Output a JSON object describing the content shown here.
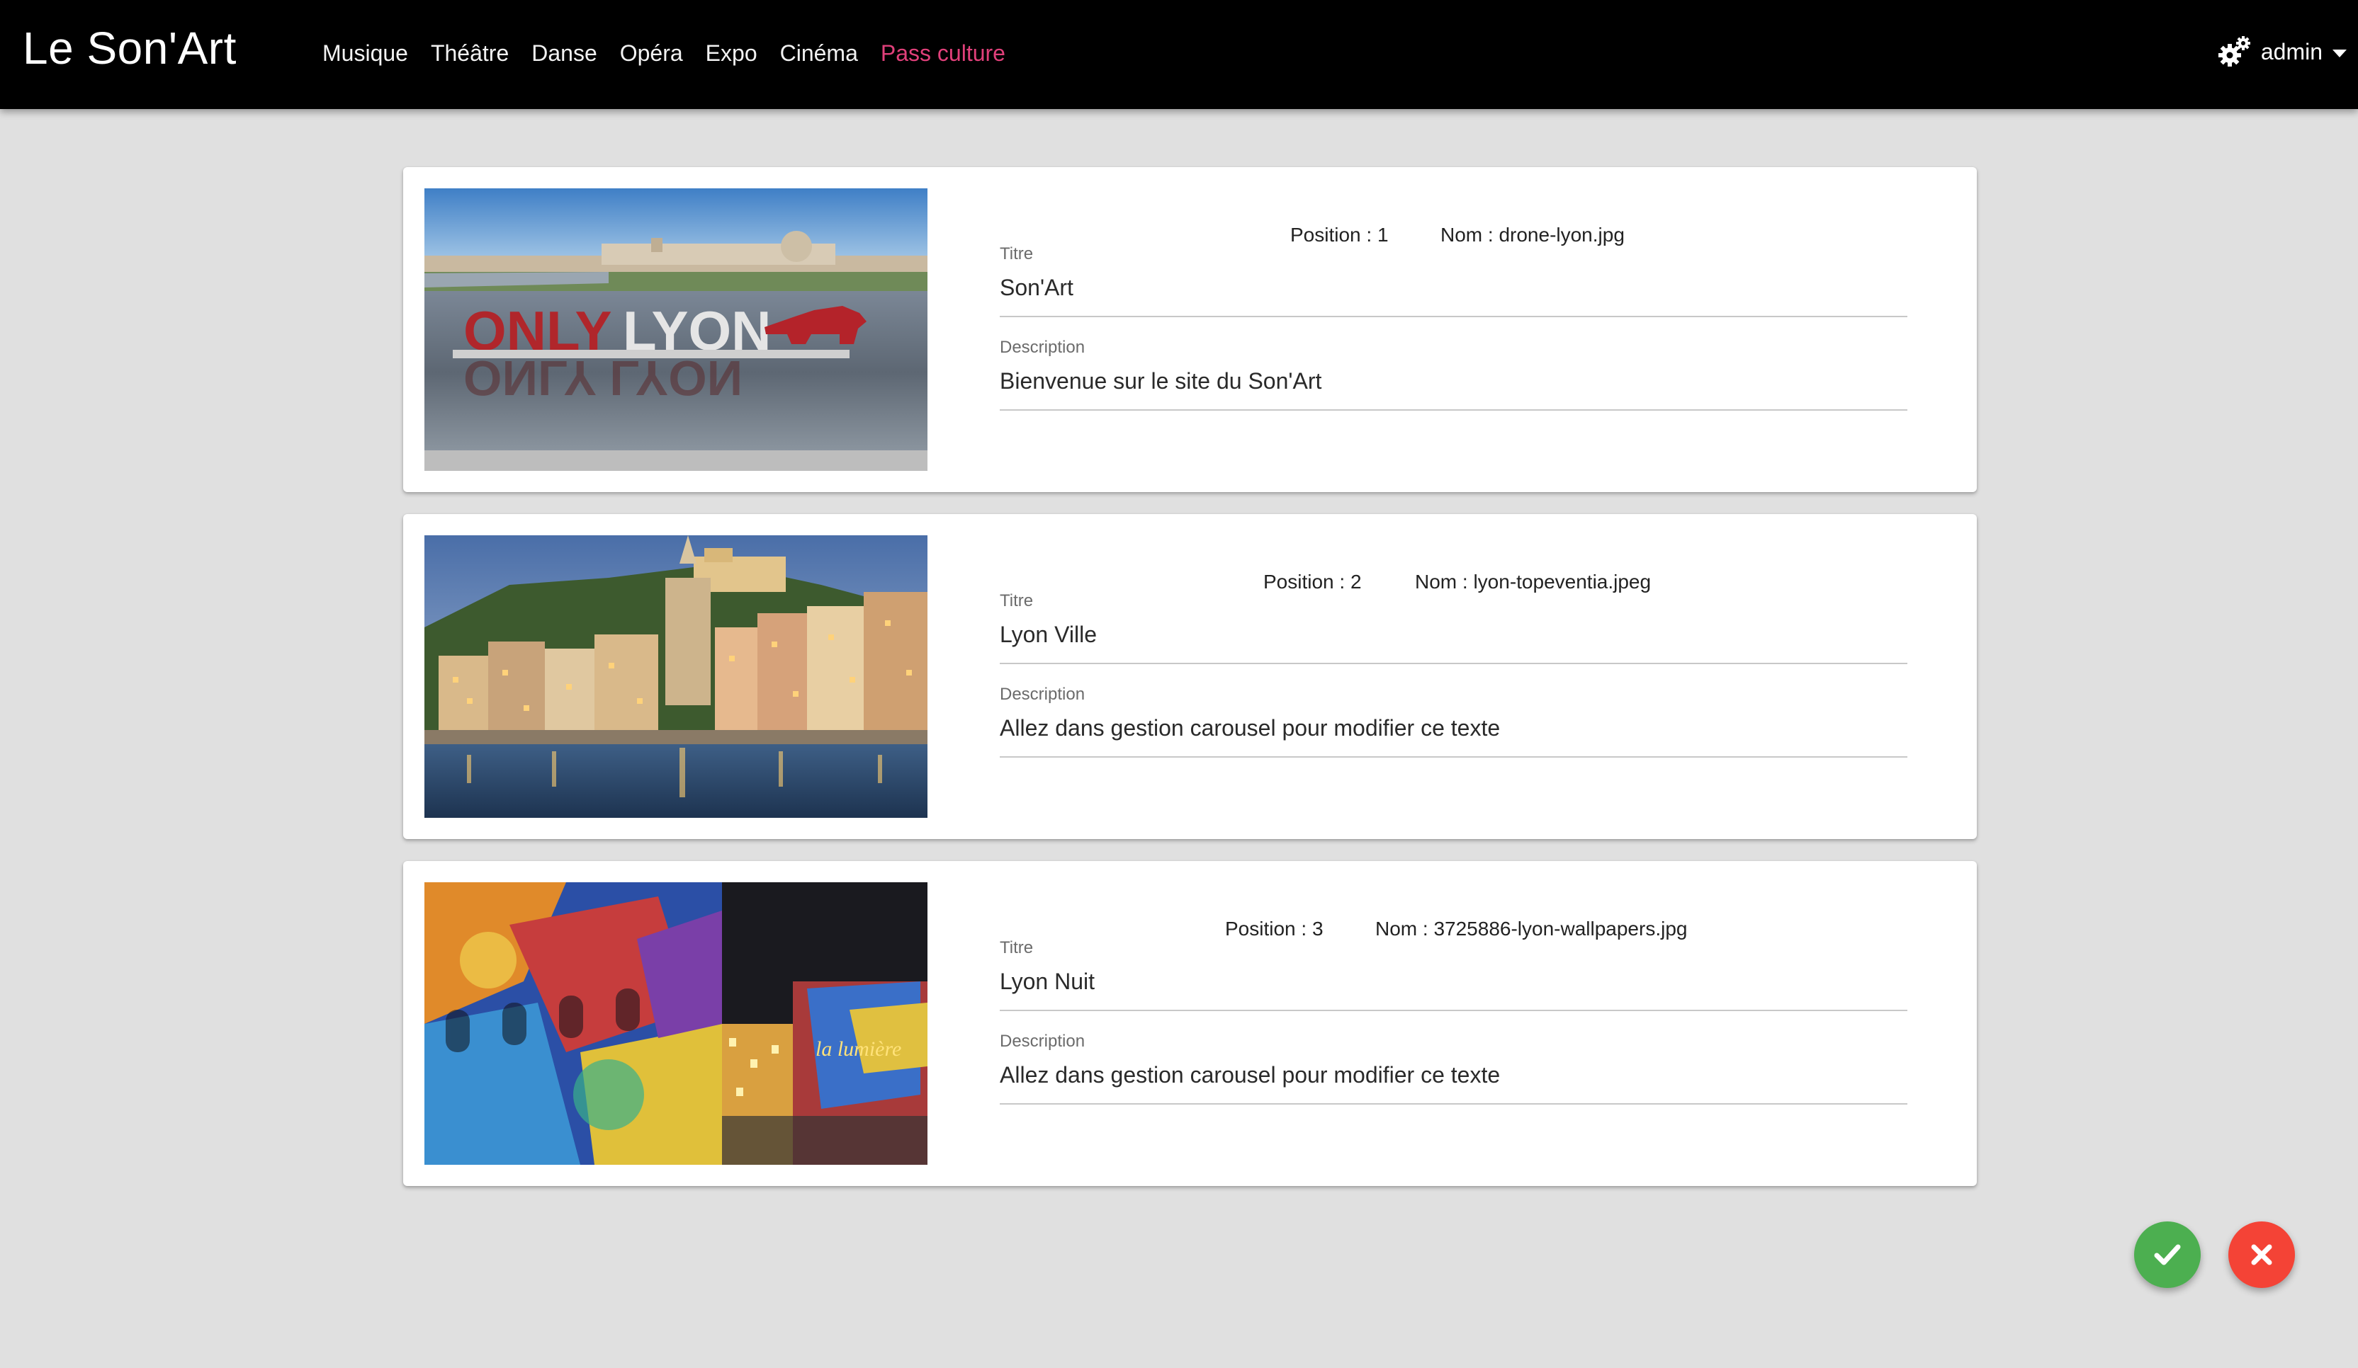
{
  "navbar": {
    "brand": "Le Son'Art",
    "links": [
      {
        "label": "Musique"
      },
      {
        "label": "Théâtre"
      },
      {
        "label": "Danse"
      },
      {
        "label": "Opéra"
      },
      {
        "label": "Expo"
      },
      {
        "label": "Cinéma"
      },
      {
        "label": "Pass culture"
      }
    ],
    "accent_color": "#e0407a",
    "user": {
      "name": "admin",
      "icon": "gears-icon"
    }
  },
  "labels": {
    "title": "Titre",
    "description": "Description"
  },
  "slides": [
    {
      "position": "Position : 1",
      "filename": "Nom : drone-lyon.jpg",
      "title": "Son'Art",
      "description": "Bienvenue sur le site du Son'Art",
      "image": "onlylyon-photo"
    },
    {
      "position": "Position : 2",
      "filename": "Nom : lyon-topeventia.jpeg",
      "title": "Lyon Ville",
      "description": "Allez dans gestion carousel pour modifier ce texte",
      "image": "lyon-city-photo"
    },
    {
      "position": "Position : 3",
      "filename": "Nom : 3725886-lyon-wallpapers.jpg",
      "title": "Lyon Nuit",
      "description": "Allez dans gestion carousel pour modifier ce texte",
      "image": "lyon-night-photo"
    }
  ],
  "actions": {
    "confirm": {
      "icon": "check-icon",
      "color": "#4caf50"
    },
    "cancel": {
      "icon": "close-icon",
      "color": "#f44336"
    }
  }
}
